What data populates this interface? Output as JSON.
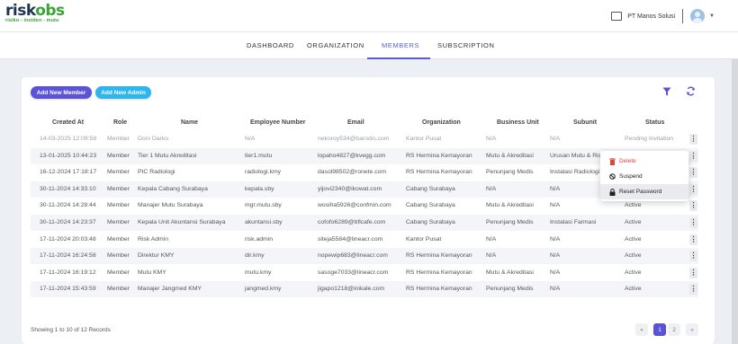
{
  "logo": {
    "part1": "risk",
    "part2": "obs",
    "tagline": "risiko - insiden - mutu"
  },
  "header": {
    "company": "PT Manos Solusi"
  },
  "nav": [
    "DASHBOARD",
    "ORGANIZATION",
    "MEMBERS",
    "SUBSCRIPTION"
  ],
  "nav_active": "MEMBERS",
  "toolbar": {
    "add_member": "Add New Member",
    "add_admin": "Add New Admin"
  },
  "table": {
    "headers": [
      "Created At",
      "Role",
      "Name",
      "Employee Number",
      "Email",
      "Organization",
      "Business Unit",
      "Subunit",
      "Status"
    ],
    "rows": [
      [
        "14-03-2025 12:09:58",
        "Member",
        "Doni Darko",
        "N/A",
        "nekoroy534@barodis.com",
        "Kantor Pusat",
        "N/A",
        "N/A",
        "Pending Invitation"
      ],
      [
        "13-01-2025 10:44:23",
        "Member",
        "Tier 1 Mutu Akreditasi",
        "tier1.mutu",
        "lopaho4827@kvegg.com",
        "RS Hermina Kemayoran",
        "Mutu & Akreditasi",
        "Urusan Mutu & Risi",
        ""
      ],
      [
        "16-12-2024 17:18:17",
        "Member",
        "PIC Radiologi",
        "radiologi.kmy",
        "dasol98502@ronete.com",
        "RS Hermina Kemayoran",
        "Penunjang Medis",
        "Instalasi Radiologi",
        ""
      ],
      [
        "30-11-2024 14:33:10",
        "Member",
        "Kepala Cabang Surabaya",
        "kepala.sby",
        "yijovi2340@ikowat.com",
        "Cabang Surabaya",
        "N/A",
        "N/A",
        ""
      ],
      [
        "30-11-2024 14:28:44",
        "Member",
        "Manajer Mutu Surabaya",
        "mgr.mutu.sby",
        "wosiha5926@confmin.com",
        "Cabang Surabaya",
        "Mutu & Akreditasi",
        "N/A",
        "Active"
      ],
      [
        "30-11-2024 14:23:37",
        "Member",
        "Kepala Unit Akuntansi Surabaya",
        "akuntansi.sby",
        "cofofo6289@bflcafe.com",
        "Cabang Surabaya",
        "Penunjang Medis",
        "Instalasi Farmasi",
        "Active"
      ],
      [
        "17-11-2024 20:03:48",
        "Member",
        "Risk Admin",
        "risk.admin",
        "siteja5584@lineacr.com",
        "Kantor Pusat",
        "N/A",
        "N/A",
        "Active"
      ],
      [
        "17-11-2024 16:24:58",
        "Member",
        "Direktur KMY",
        "dir.kmy",
        "nopewip683@lineacr.com",
        "RS Hermina Kemayoran",
        "N/A",
        "N/A",
        "Active"
      ],
      [
        "17-11-2024 16:19:12",
        "Member",
        "Mutu KMY",
        "mutu.kmy",
        "sasoge7033@lineacr.com",
        "RS Hermina Kemayoran",
        "Mutu & Akreditasi",
        "N/A",
        "Active"
      ],
      [
        "17-11-2024 15:43:59",
        "Member",
        "Manajer Jangmed KMY",
        "jangmed.kmy",
        "jigapo1218@inikale.com",
        "RS Hermina Kemayoran",
        "Penunjang Medis",
        "N/A",
        "Active"
      ]
    ]
  },
  "row_menu": {
    "delete": "Delete",
    "suspend": "Suspend",
    "reset": "Reset Password"
  },
  "footer": {
    "records": "Showing 1 to 10 of 12 Records",
    "pages": [
      "«",
      "1",
      "2",
      "»"
    ]
  },
  "colors": {
    "primary": "#5b53d6",
    "secondary": "#2fb5ee",
    "brand_dark": "#1c3550",
    "brand_green": "#3aa335",
    "danger": "#e0453b"
  }
}
